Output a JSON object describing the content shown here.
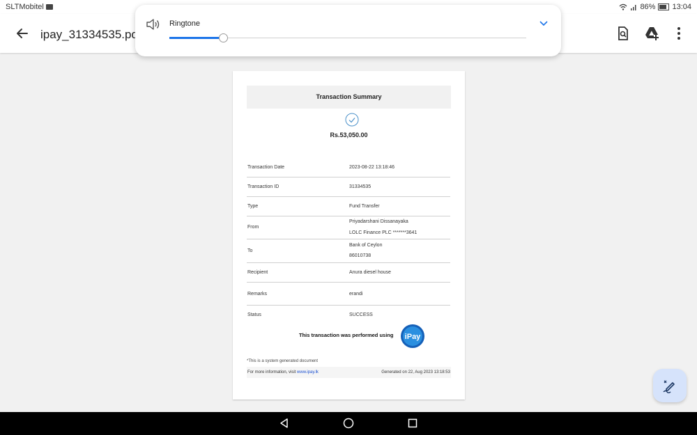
{
  "status_bar": {
    "carrier": "SLTMobitel",
    "battery": "86%",
    "time": "13:04"
  },
  "app_bar": {
    "title": "ipay_31334535.pdf",
    "back_icon": "arrow-left-icon",
    "actions": [
      "find-in-page-icon",
      "add-to-drive-icon",
      "more-vert-icon"
    ]
  },
  "volume_panel": {
    "label": "Ringtone",
    "level": 0.15,
    "icon": "speaker-icon",
    "expand_icon": "chevron-down-icon"
  },
  "document": {
    "heading": "Transaction Summary",
    "amount": "Rs.53,050.00",
    "rows": [
      {
        "label": "Transaction Date",
        "value": "2023-08-22 13:18:46"
      },
      {
        "label": "Transaction ID",
        "value": "31334535"
      },
      {
        "label": "Type",
        "value": "Fund Transfer"
      },
      {
        "label": "From",
        "value": "Priyadarshani Dissanayaka",
        "value2": "LOLC Finance PLC *******3641"
      },
      {
        "label": "To",
        "value": "Bank of Ceylon",
        "value2": "86010738"
      },
      {
        "label": "Recipient",
        "value": "Anura diesel house"
      },
      {
        "label": "Remarks",
        "value": "erandi"
      },
      {
        "label": "Status",
        "value": "SUCCESS"
      }
    ],
    "performed_text": "This transaction was performed using",
    "logo_text": "iPay",
    "system_note": "*This is a system generated document",
    "footer_info_prefix": "For more information, visit ",
    "footer_link": "www.ipay.lk",
    "footer_generated": "Generated on 22, Aug 2023 13:18:53"
  },
  "fab": {
    "icon": "annotate-pen-icon"
  },
  "nav_bar": {
    "icons": [
      "back-triangle-icon",
      "home-circle-icon",
      "recents-square-icon"
    ]
  }
}
